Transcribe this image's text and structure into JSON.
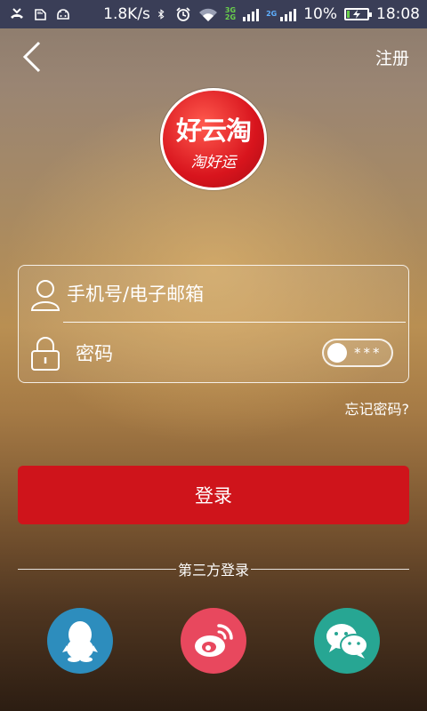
{
  "status_bar": {
    "network_speed": "1.8K/s",
    "net_badge_top": "3G",
    "net_badge_bottom": "2G",
    "net_badge_second": "2G",
    "battery": "10%",
    "time": "18:08",
    "icons": [
      "missed-call-icon",
      "sd-card-icon",
      "android-icon",
      "bluetooth-icon",
      "alarm-icon",
      "wifi-icon",
      "signal-icon",
      "battery-icon"
    ]
  },
  "header": {
    "back_icon": "chevron-left-icon",
    "register_label": "注册"
  },
  "logo": {
    "main_text": "好云淘",
    "sub_text": "淘好运",
    "color": "#d8141d"
  },
  "form": {
    "phone_placeholder": "手机号/电子邮箱",
    "password_placeholder": "密码",
    "user_icon": "user-icon",
    "lock_icon": "lock-icon",
    "toggle_dots": "***"
  },
  "forgot_label": "忘记密码?",
  "login_button": {
    "label": "登录",
    "color": "#cf141b"
  },
  "third_party": {
    "title": "第三方登录",
    "providers": [
      {
        "name": "qq-icon",
        "color": "#2d8dbd"
      },
      {
        "name": "weibo-icon",
        "color": "#e8485e"
      },
      {
        "name": "wechat-icon",
        "color": "#27a693"
      }
    ]
  }
}
